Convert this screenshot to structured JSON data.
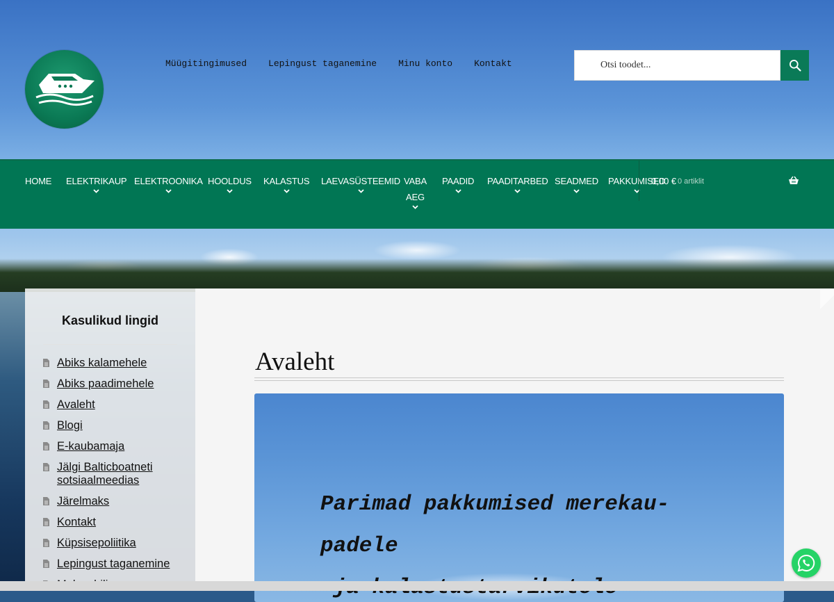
{
  "header": {
    "secondary_nav": [
      {
        "label": "Müügitingimused"
      },
      {
        "label": "Lepingust taganemine"
      },
      {
        "label": "Minu konto"
      },
      {
        "label": "Kontakt"
      }
    ],
    "search": {
      "placeholder": "Otsi toodet..."
    }
  },
  "primary_nav": {
    "items": [
      {
        "label": "HOME",
        "has_dropdown": false
      },
      {
        "label": "ELEKTRIKAUP",
        "has_dropdown": true
      },
      {
        "label": "ELEKTROONIKA",
        "has_dropdown": true
      },
      {
        "label": "HOOLDUS",
        "has_dropdown": true
      },
      {
        "label": "KALASTUS",
        "has_dropdown": true
      },
      {
        "label": "LAEVASÜSTEEMID",
        "has_dropdown": true
      },
      {
        "label": "VABA",
        "label_line2": "AEG",
        "has_dropdown": true
      },
      {
        "label": "PAADID",
        "has_dropdown": true
      },
      {
        "label": "PAADITARBED",
        "has_dropdown": true
      },
      {
        "label": "SEADMED",
        "has_dropdown": true
      },
      {
        "label": "PAKKUMISED",
        "has_dropdown": true
      }
    ],
    "cart": {
      "amount": "0,00 €",
      "count": "0 artiklit"
    }
  },
  "sidebar": {
    "title": "Kasulikud lingid",
    "links": [
      {
        "label": "Abiks kalamehele"
      },
      {
        "label": "Abiks paadimehele"
      },
      {
        "label": "Avaleht"
      },
      {
        "label": "Blogi"
      },
      {
        "label": "E-kaubamaja"
      },
      {
        "label": "Jälgi Balticboatneti sotsiaalmeedias"
      },
      {
        "label": "Järelmaks"
      },
      {
        "label": "Kontakt"
      },
      {
        "label": "Küpsisepoliitika"
      },
      {
        "label": "Lepingust taganemine"
      },
      {
        "label": "Maksa hiljem"
      }
    ]
  },
  "main": {
    "title": "Avaleht",
    "hero_text_lines": [
      "Parimad pakkumised merekau-",
      "padele",
      " ja kalastustarvikutele"
    ]
  },
  "colors": {
    "brand_green": "#017654",
    "search_button": "#0a7a57",
    "whatsapp": "#25d366"
  },
  "icons": {
    "search": "search-icon",
    "cart": "basket-icon",
    "chat": "whatsapp-icon",
    "link": "document-icon"
  }
}
